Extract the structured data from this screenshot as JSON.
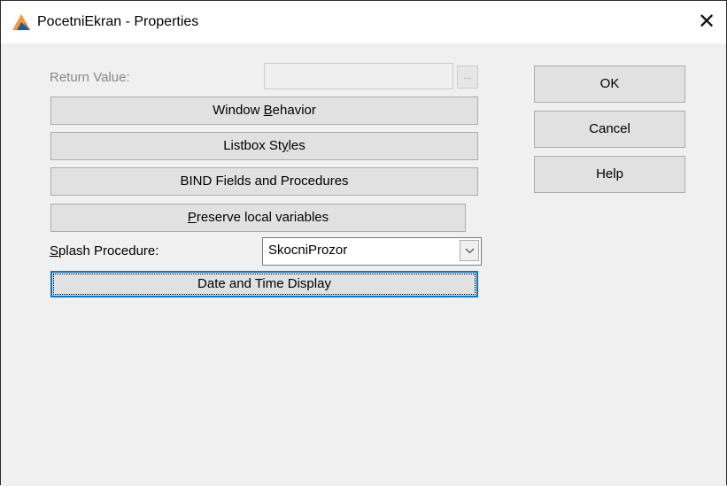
{
  "window": {
    "title": "PocetniEkran - Properties",
    "close_glyph": "✕"
  },
  "form": {
    "return_value_label": "Return Value:",
    "return_value": "",
    "ellipsis_label": "...",
    "window_behavior": {
      "pre": "Window ",
      "ul": "B",
      "post": "ehavior"
    },
    "listbox_styles": {
      "pre": "Listbox St",
      "ul": "y",
      "post": "les"
    },
    "bind_fields_label": "BIND Fields and Procedures",
    "preserve_locals": {
      "pre": "",
      "ul": "P",
      "post": "reserve local variables"
    },
    "splash_label": {
      "pre": "",
      "ul": "S",
      "post": "plash Procedure:"
    },
    "splash_value": "SkocniProzor",
    "date_time_label": "Date and Time Display"
  },
  "actions": {
    "ok_label": "OK",
    "cancel_label": "Cancel",
    "help_label": "Help"
  },
  "icons": {
    "app": "clarion-triangle-icon",
    "dropdown": "chevron-down-icon"
  },
  "colors": {
    "accent": "#0078d7",
    "icon_orange": "#e8762d",
    "icon_blue": "#1e5aa8"
  }
}
